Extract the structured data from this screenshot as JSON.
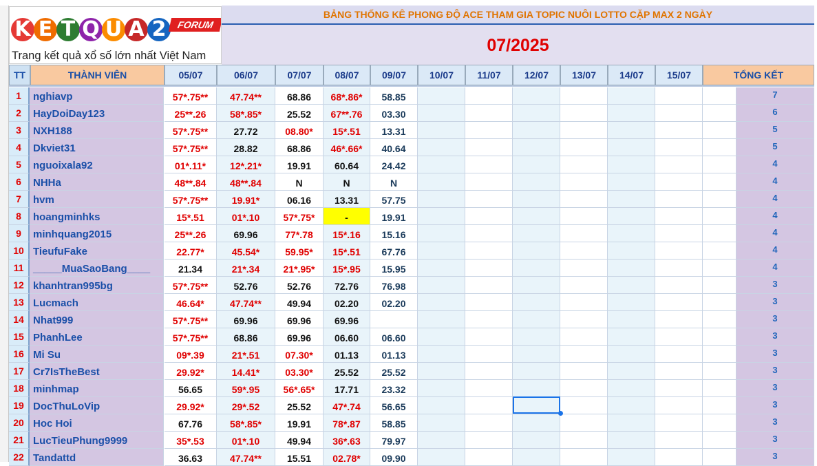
{
  "logo": {
    "letters": [
      "K",
      "E",
      "T",
      "Q",
      "U",
      "A",
      "2"
    ],
    "forum": "FORUM",
    "slogan": "Trang kết quả xổ số lớn nhất Việt Nam"
  },
  "title": "BẢNG THỐNG KÊ PHONG ĐỘ ACE THAM GIA TOPIC NUÔI LOTTO CẶP MAX 2 NGÀY",
  "month": "07/2025",
  "headers": {
    "tt": "TT",
    "name": "THÀNH VIÊN",
    "dates": [
      "05/07",
      "06/07",
      "07/07",
      "08/07",
      "09/07",
      "10/07",
      "11/07",
      "12/07",
      "13/07",
      "14/07",
      "15/07"
    ],
    "total": "TỔNG KẾT"
  },
  "colors": {
    "win": "#e00000",
    "plain": "#111111",
    "highlight": "#ffff00",
    "selection": "#1a73e8"
  },
  "rows": [
    {
      "tt": "1",
      "name": "nghiavp",
      "vals": [
        "57*.75**",
        "47.74**",
        "68.86",
        "68*.86*",
        "58.85"
      ],
      "red": [
        1,
        1,
        0,
        1,
        0
      ],
      "total": "7"
    },
    {
      "tt": "2",
      "name": "HayDoiDay123",
      "vals": [
        "25**.26",
        "58*.85*",
        "25.52",
        "67**.76",
        "03.30"
      ],
      "red": [
        1,
        1,
        0,
        1,
        0
      ],
      "total": "6"
    },
    {
      "tt": "3",
      "name": "NXH188",
      "vals": [
        "57*.75**",
        "27.72",
        "08.80*",
        "15*.51",
        "13.31"
      ],
      "red": [
        1,
        0,
        1,
        1,
        0
      ],
      "total": "5"
    },
    {
      "tt": "4",
      "name": "Dkviet31",
      "vals": [
        "57*.75**",
        "28.82",
        "68.86",
        "46*.66*",
        "40.64"
      ],
      "red": [
        1,
        0,
        0,
        1,
        0
      ],
      "total": "5"
    },
    {
      "tt": "5",
      "name": "nguoixala92",
      "vals": [
        "01*.11*",
        "12*.21*",
        "19.91",
        "60.64",
        "24.42"
      ],
      "red": [
        1,
        1,
        0,
        0,
        0
      ],
      "total": "4"
    },
    {
      "tt": "6",
      "name": "NHHa",
      "vals": [
        "48**.84",
        "48**.84",
        "N",
        "N",
        "N"
      ],
      "red": [
        1,
        1,
        0,
        0,
        0
      ],
      "total": "4"
    },
    {
      "tt": "7",
      "name": "hvm",
      "vals": [
        "57*.75**",
        "19.91*",
        "06.16",
        "13.31",
        "57.75"
      ],
      "red": [
        1,
        1,
        0,
        0,
        0
      ],
      "total": "4"
    },
    {
      "tt": "8",
      "name": "hoangminhks",
      "vals": [
        "15*.51",
        "01*.10",
        "57*.75*",
        "-",
        "19.91"
      ],
      "red": [
        1,
        1,
        1,
        0,
        0
      ],
      "total": "4"
    },
    {
      "tt": "9",
      "name": "minhquang2015",
      "vals": [
        "25**.26",
        "69.96",
        "77*.78",
        "15*.16",
        "15.16"
      ],
      "red": [
        1,
        0,
        1,
        1,
        0
      ],
      "total": "4"
    },
    {
      "tt": "10",
      "name": "TieufuFake",
      "vals": [
        "22.77*",
        "45.54*",
        "59.95*",
        "15*.51",
        "67.76"
      ],
      "red": [
        1,
        1,
        1,
        1,
        0
      ],
      "total": "4"
    },
    {
      "tt": "11",
      "name": "_____MuaSaoBang____",
      "vals": [
        "21.34",
        "21*.34",
        "21*.95*",
        "15*.95",
        "15.95"
      ],
      "red": [
        0,
        1,
        1,
        1,
        0
      ],
      "total": "4"
    },
    {
      "tt": "12",
      "name": "khanhtran995bg",
      "vals": [
        "57*.75**",
        "52.76",
        "52.76",
        "72.76",
        "76.98"
      ],
      "red": [
        1,
        0,
        0,
        0,
        0
      ],
      "total": "3"
    },
    {
      "tt": "13",
      "name": "Lucmach",
      "vals": [
        "46.64*",
        "47.74**",
        "49.94",
        "02.20",
        "02.20"
      ],
      "red": [
        1,
        1,
        0,
        0,
        0
      ],
      "total": "3"
    },
    {
      "tt": "14",
      "name": "Nhat999",
      "vals": [
        "57*.75**",
        "69.96",
        "69.96",
        "69.96",
        ""
      ],
      "red": [
        1,
        0,
        0,
        0,
        0
      ],
      "total": "3"
    },
    {
      "tt": "15",
      "name": "PhanhLee",
      "vals": [
        "57*.75**",
        "68.86",
        "69.96",
        "06.60",
        "06.60"
      ],
      "red": [
        1,
        0,
        0,
        0,
        0
      ],
      "total": "3"
    },
    {
      "tt": "16",
      "name": "Mi Su",
      "vals": [
        "09*.39",
        "21*.51",
        "07.30*",
        "01.13",
        "01.13"
      ],
      "red": [
        1,
        1,
        1,
        0,
        0
      ],
      "total": "3"
    },
    {
      "tt": "17",
      "name": "Cr7IsTheBest",
      "vals": [
        "29.92*",
        "14.41*",
        "03.30*",
        "25.52",
        "25.52"
      ],
      "red": [
        1,
        1,
        1,
        0,
        0
      ],
      "total": "3"
    },
    {
      "tt": "18",
      "name": "minhmap",
      "vals": [
        "56.65",
        "59*.95",
        "56*.65*",
        "17.71",
        "23.32"
      ],
      "red": [
        0,
        1,
        1,
        0,
        0
      ],
      "total": "3"
    },
    {
      "tt": "19",
      "name": "DocThuLoVip",
      "vals": [
        "29.92*",
        "29*.52",
        "25.52",
        "47*.74",
        "56.65"
      ],
      "red": [
        1,
        1,
        0,
        1,
        0
      ],
      "total": "3"
    },
    {
      "tt": "20",
      "name": "Hoc Hoi",
      "vals": [
        "67.76",
        "58*.85*",
        "19.91",
        "78*.87",
        "58.85"
      ],
      "red": [
        0,
        1,
        0,
        1,
        0
      ],
      "total": "3"
    },
    {
      "tt": "21",
      "name": "LucTieuPhung9999",
      "vals": [
        "35*.53",
        "01*.10",
        "49.94",
        "36*.63",
        "79.97"
      ],
      "red": [
        1,
        1,
        0,
        1,
        0
      ],
      "total": "3"
    },
    {
      "tt": "22",
      "name": "Tandattd",
      "vals": [
        "36.63",
        "47.74**",
        "15.51",
        "02.78*",
        "09.90"
      ],
      "red": [
        0,
        1,
        0,
        1,
        0
      ],
      "total": "3"
    }
  ]
}
